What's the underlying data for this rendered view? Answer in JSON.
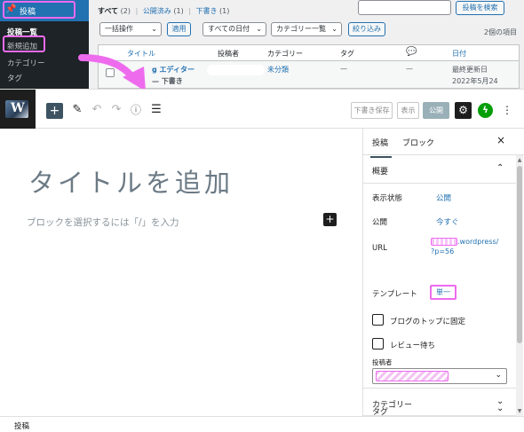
{
  "admin": {
    "menu_posts": "投稿",
    "submenu": [
      "投稿一覧",
      "新規追加",
      "カテゴリー",
      "タグ"
    ],
    "filters": {
      "all": "すべて",
      "all_count": "(2)",
      "published": "公開済み",
      "published_count": "(1)",
      "draft": "下書き",
      "draft_count": "(1)"
    },
    "search_button": "投稿を検索",
    "bulk_action": "一括操作",
    "apply": "適用",
    "all_dates": "すべての日付",
    "all_categories": "カテゴリー一覧",
    "filter_button": "絞り込み",
    "items_count": "2個の項目",
    "columns": [
      "タイトル",
      "投稿者",
      "カテゴリー",
      "タグ",
      "日付"
    ],
    "row": {
      "title": "Gutenberg エディター",
      "title_display": "g エディター",
      "state": "— 下書き",
      "category": "未分類",
      "tags": "—",
      "comments": "—",
      "date_label": "最終更新日",
      "date": "2022年5月24"
    }
  },
  "editor": {
    "logo_letter": "W",
    "toolbar": {
      "add_icon": "+",
      "save_draft": "下書き保存",
      "preview": "表示",
      "publish": "公開",
      "more_icon": "⋮"
    },
    "title_placeholder": "タイトルを追加",
    "block_hint": "ブロックを選択するには「/」を入力",
    "sidebar": {
      "tab_post": "投稿",
      "tab_block": "ブロック",
      "close": "×",
      "summary": "概要",
      "visibility_label": "表示状態",
      "visibility_value": "公開",
      "publish_label": "公開",
      "publish_value": "今すぐ",
      "url_label": "URL",
      "url_suffix": ".wordpress/",
      "url_query": "?p=56",
      "template_label": "テンプレート",
      "template_value": "単一",
      "sticky_label": "ブログのトップに固定",
      "pending_label": "レビュー待ち",
      "author_label": "投稿者",
      "categories_panel": "カテゴリー",
      "tags_panel": "タグ"
    },
    "breadcrumb": "投稿"
  },
  "colors": {
    "highlight": "#ee6bee",
    "wp_blue": "#2271b1",
    "admin_sidebar": "#1d2327",
    "publish_disabled": "#9ab0b8",
    "jetpack_green": "#069e08"
  }
}
